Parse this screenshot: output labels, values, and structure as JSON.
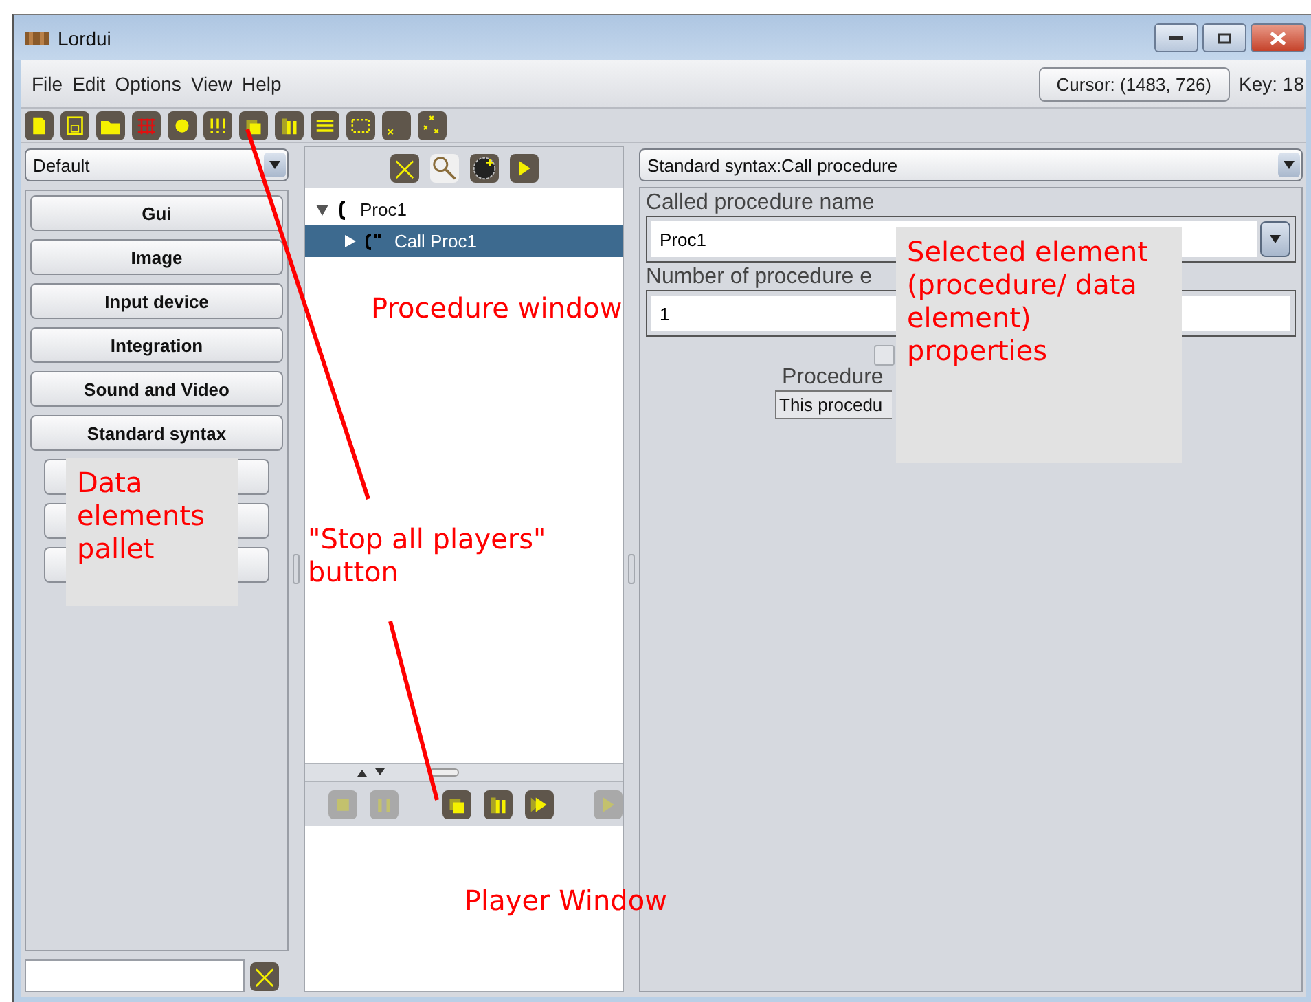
{
  "window": {
    "title": "Lordui"
  },
  "menu": [
    "File",
    "Edit",
    "Options",
    "View",
    "Help"
  ],
  "cursor_button": "Cursor: (1483, 726)",
  "key_label": "Key: 18",
  "palette": {
    "selector": "Default",
    "categories": [
      {
        "label": "Gui",
        "disabled": false
      },
      {
        "label": "Image",
        "disabled": false
      },
      {
        "label": "Input device",
        "disabled": false
      },
      {
        "label": "Integration",
        "disabled": false
      },
      {
        "label": "Sound and Video",
        "disabled": false
      },
      {
        "label": "Standard syntax",
        "disabled": false
      }
    ]
  },
  "tree": [
    {
      "label": "Proc1",
      "kind": "procedure",
      "expanded": true,
      "selected": false,
      "children": [
        {
          "label": "Call Proc1",
          "kind": "call",
          "expanded": false,
          "selected": true
        }
      ]
    }
  ],
  "player_buttons": [
    {
      "kind": "stop",
      "disabled": true
    },
    {
      "kind": "pause",
      "disabled": true
    },
    {
      "kind": "stop_all",
      "disabled": false
    },
    {
      "kind": "pause_all",
      "disabled": false
    },
    {
      "kind": "play_all",
      "disabled": false
    },
    {
      "kind": "play",
      "disabled": true
    }
  ],
  "properties": {
    "selector": "Standard syntax:Call procedure",
    "called_label": "Called procedure name",
    "called_value": "Proc1",
    "count_label": "Number of procedure e",
    "count_value": "1",
    "thread": {
      "checked": false,
      "disabled": true
    },
    "args_label": "Procedure",
    "args_text": "This procedu"
  },
  "annotations": [
    {
      "kind": "plain",
      "text": "Procedure window"
    },
    {
      "kind": "boxed",
      "text": "Data elements pallet"
    },
    {
      "kind": "plain",
      "text": "\"Stop all players\" button"
    },
    {
      "kind": "boxed",
      "text": "Selected element (procedure/ data element) properties"
    },
    {
      "kind": "plain",
      "text": "Player Window"
    }
  ]
}
